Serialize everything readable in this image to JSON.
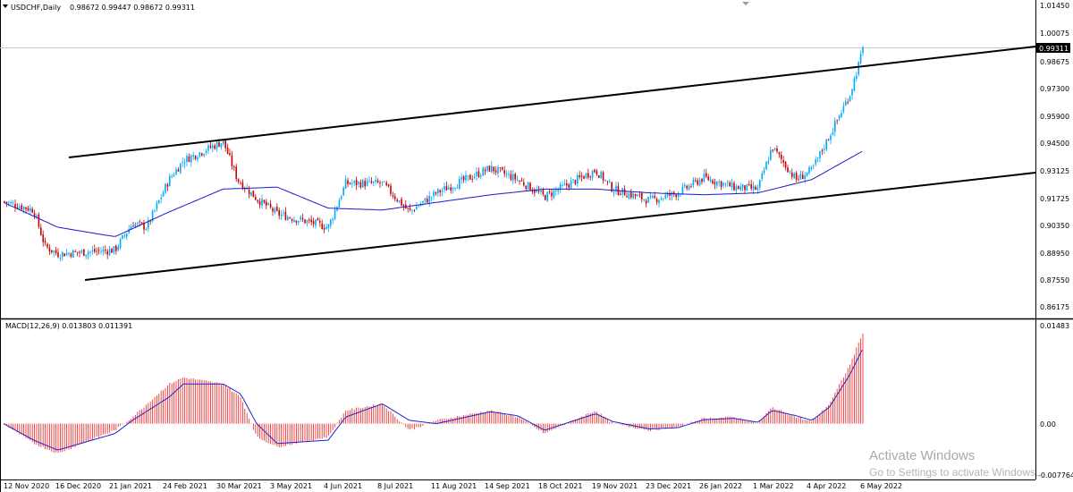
{
  "chart_data": [
    {
      "type": "candlestick",
      "symbol_label": "USDCHF,Daily",
      "ohlc_label": "0.98672 0.99447 0.98672 0.99311",
      "last_price_label": "0.99311",
      "ylim": [
        0.8582,
        1.0164
      ],
      "y_ticks": [
        "1.01450",
        "1.00075",
        "0.98675",
        "0.97300",
        "0.95900",
        "0.94500",
        "0.93125",
        "0.91725",
        "0.90350",
        "0.88950",
        "0.87550",
        "0.86175"
      ],
      "x_ticks": [
        "12 Nov 2020",
        "16 Dec 2020",
        "21 Jan 2021",
        "24 Feb 2021",
        "30 Mar 2021",
        "3 May 2021",
        "4 Jun 2021",
        "8 Jul 2021",
        "11 Aug 2021",
        "14 Sep 2021",
        "18 Oct 2021",
        "19 Nov 2021",
        "23 Dec 2021",
        "26 Jan 2022",
        "1 Mar 2022",
        "4 Apr 2022",
        "6 May 2022"
      ],
      "close_path": [
        [
          "12 Nov 2020",
          0.9135
        ],
        [
          "1 Dec 2020",
          0.909
        ],
        [
          "8 Dec 2020",
          0.89
        ],
        [
          "16 Dec 2020",
          0.886
        ],
        [
          "21 Jan 2021",
          0.888
        ],
        [
          "1 Feb 2021",
          0.902
        ],
        [
          "10 Feb 2021",
          0.9
        ],
        [
          "24 Feb 2021",
          0.925
        ],
        [
          "5 Mar 2021",
          0.935
        ],
        [
          "30 Mar 2021",
          0.945
        ],
        [
          "8 Apr 2021",
          0.925
        ],
        [
          "20 Apr 2021",
          0.915
        ],
        [
          "3 May 2021",
          0.907
        ],
        [
          "4 Jun 2021",
          0.9
        ],
        [
          "15 Jun 2021",
          0.923
        ],
        [
          "8 Jul 2021",
          0.923
        ],
        [
          "25 Jul 2021",
          0.908
        ],
        [
          "11 Aug 2021",
          0.918
        ],
        [
          "14 Sep 2021",
          0.931
        ],
        [
          "1 Oct 2021",
          0.925
        ],
        [
          "18 Oct 2021",
          0.916
        ],
        [
          "19 Nov 2021",
          0.93
        ],
        [
          "30 Nov 2021",
          0.92
        ],
        [
          "23 Dec 2021",
          0.914
        ],
        [
          "10 Jan 2022",
          0.918
        ],
        [
          "26 Jan 2022",
          0.926
        ],
        [
          "14 Feb 2022",
          0.921
        ],
        [
          "1 Mar 2022",
          0.92
        ],
        [
          "10 Mar 2022",
          0.942
        ],
        [
          "25 Mar 2022",
          0.925
        ],
        [
          "4 Apr 2022",
          0.93
        ],
        [
          "15 Apr 2022",
          0.948
        ],
        [
          "28 Apr 2022",
          0.97
        ],
        [
          "6 May 2022",
          0.9931
        ]
      ],
      "moving_average_path": [
        [
          "12 Nov 2020",
          0.913
        ],
        [
          "16 Dec 2020",
          0.9
        ],
        [
          "21 Jan 2021",
          0.895
        ],
        [
          "24 Feb 2021",
          0.908
        ],
        [
          "30 Mar 2021",
          0.92
        ],
        [
          "3 May 2021",
          0.921
        ],
        [
          "4 Jun 2021",
          0.91
        ],
        [
          "8 Jul 2021",
          0.909
        ],
        [
          "11 Aug 2021",
          0.913
        ],
        [
          "14 Sep 2021",
          0.917
        ],
        [
          "18 Oct 2021",
          0.92
        ],
        [
          "19 Nov 2021",
          0.92
        ],
        [
          "23 Dec 2021",
          0.918
        ],
        [
          "26 Jan 2022",
          0.917
        ],
        [
          "1 Mar 2022",
          0.918
        ],
        [
          "4 Apr 2022",
          0.925
        ],
        [
          "6 May 2022",
          0.94
        ]
      ],
      "grid": false,
      "colors": {
        "bull": "#00aaff",
        "bear": "#cc0000",
        "ma": "#1a1acc",
        "channel": "#000000"
      }
    },
    {
      "type": "bar+line",
      "label": "MACD(12,26,9) 0.013803 0.011391",
      "ylim": [
        -0.00777,
        0.01483
      ],
      "y_ticks": [
        "0.01483",
        "0.00",
        "-0.007764"
      ],
      "histogram_path": [
        [
          "12 Nov 2020",
          0.0
        ],
        [
          "1 Dec 2020",
          -0.003
        ],
        [
          "16 Dec 2020",
          -0.0045
        ],
        [
          "21 Jan 2021",
          -0.001
        ],
        [
          "1 Feb 2021",
          0.001
        ],
        [
          "24 Feb 2021",
          0.006
        ],
        [
          "5 Mar 2021",
          0.007
        ],
        [
          "30 Mar 2021",
          0.006
        ],
        [
          "10 Apr 2021",
          0.004
        ],
        [
          "20 Apr 2021",
          -0.002
        ],
        [
          "3 May 2021",
          -0.0035
        ],
        [
          "4 Jun 2021",
          -0.002
        ],
        [
          "15 Jun 2021",
          0.002
        ],
        [
          "8 Jul 2021",
          0.003
        ],
        [
          "25 Jul 2021",
          -0.001
        ],
        [
          "11 Aug 2021",
          0.0005
        ],
        [
          "14 Sep 2021",
          0.002
        ],
        [
          "1 Oct 2021",
          0.001
        ],
        [
          "18 Oct 2021",
          -0.0015
        ],
        [
          "19 Nov 2021",
          0.002
        ],
        [
          "30 Nov 2021",
          0.0
        ],
        [
          "23 Dec 2021",
          -0.001
        ],
        [
          "10 Jan 2022",
          -0.0005
        ],
        [
          "26 Jan 2022",
          0.0008
        ],
        [
          "14 Feb 2022",
          0.001
        ],
        [
          "1 Mar 2022",
          0.0
        ],
        [
          "10 Mar 2022",
          0.0025
        ],
        [
          "25 Mar 2022",
          0.001
        ],
        [
          "4 Apr 2022",
          0.0003
        ],
        [
          "15 Apr 2022",
          0.003
        ],
        [
          "28 Apr 2022",
          0.009
        ],
        [
          "6 May 2022",
          0.0138
        ]
      ],
      "signal_path": [
        [
          "12 Nov 2020",
          0.0
        ],
        [
          "1 Dec 2020",
          -0.0025
        ],
        [
          "16 Dec 2020",
          -0.004
        ],
        [
          "21 Jan 2021",
          -0.0015
        ],
        [
          "1 Feb 2021",
          0.0005
        ],
        [
          "24 Feb 2021",
          0.004
        ],
        [
          "5 Mar 2021",
          0.006
        ],
        [
          "30 Mar 2021",
          0.006
        ],
        [
          "10 Apr 2021",
          0.0045
        ],
        [
          "20 Apr 2021",
          0.0
        ],
        [
          "3 May 2021",
          -0.003
        ],
        [
          "4 Jun 2021",
          -0.0025
        ],
        [
          "15 Jun 2021",
          0.001
        ],
        [
          "8 Jul 2021",
          0.003
        ],
        [
          "25 Jul 2021",
          0.0005
        ],
        [
          "11 Aug 2021",
          0.0
        ],
        [
          "14 Sep 2021",
          0.0018
        ],
        [
          "1 Oct 2021",
          0.0012
        ],
        [
          "18 Oct 2021",
          -0.001
        ],
        [
          "19 Nov 2021",
          0.0015
        ],
        [
          "30 Nov 2021",
          0.0003
        ],
        [
          "23 Dec 2021",
          -0.0008
        ],
        [
          "10 Jan 2022",
          -0.0006
        ],
        [
          "26 Jan 2022",
          0.0006
        ],
        [
          "14 Feb 2022",
          0.0008
        ],
        [
          "1 Mar 2022",
          0.0002
        ],
        [
          "10 Mar 2022",
          0.002
        ],
        [
          "25 Mar 2022",
          0.0012
        ],
        [
          "4 Apr 2022",
          0.0005
        ],
        [
          "15 Apr 2022",
          0.0025
        ],
        [
          "28 Apr 2022",
          0.0075
        ],
        [
          "6 May 2022",
          0.01139
        ]
      ],
      "colors": {
        "histogram": "#ee3333",
        "signal": "#2222cc"
      }
    }
  ],
  "watermark": {
    "line1": "Activate Windows",
    "line2": "Go to Settings to activate Windows."
  }
}
